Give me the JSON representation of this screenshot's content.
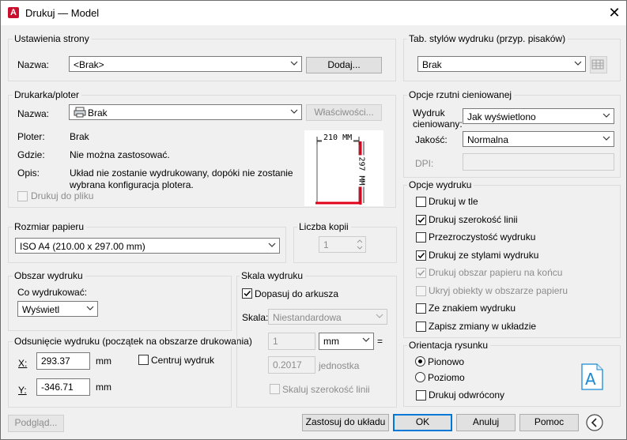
{
  "window": {
    "title": "Drukuj — Model",
    "app_icon": "A"
  },
  "page_setup": {
    "group_label": "Ustawienia strony",
    "name_label": "Nazwa:",
    "name_value": "<Brak>",
    "add_button": "Dodaj..."
  },
  "printer": {
    "group_label": "Drukarka/ploter",
    "name_label": "Nazwa:",
    "name_value": "Brak",
    "properties_button": "Właściwości...",
    "plotter_label": "Ploter:",
    "plotter_value": "Brak",
    "where_label": "Gdzie:",
    "where_value": "Nie można zastosować.",
    "desc_label": "Opis:",
    "desc_line1": "Układ nie zostanie wydrukowany, dopóki nie zostanie",
    "desc_line2": "wybrana konfiguracja plotera.",
    "print_to_file": "Drukuj do pliku",
    "paper_width": "210 MM",
    "paper_height": "297 MM"
  },
  "paper_size": {
    "group_label": "Rozmiar papieru",
    "value": "ISO A4 (210.00 x 297.00 mm)"
  },
  "copies": {
    "group_label": "Liczba kopii",
    "value": "1"
  },
  "plot_area": {
    "group_label": "Obszar wydruku",
    "what_label": "Co wydrukować:",
    "what_value": "Wyświetl"
  },
  "plot_offset": {
    "group_label": "Odsunięcie wydruku (początek na obszarze drukowania)",
    "x_label": "X:",
    "x_value": "293.37",
    "x_unit": "mm",
    "y_label": "Y:",
    "y_value": "-346.71",
    "y_unit": "mm",
    "center": "Centruj wydruk"
  },
  "plot_scale": {
    "group_label": "Skala wydruku",
    "fit_to_paper": "Dopasuj do arkusza",
    "scale_label": "Skala:",
    "scale_value": "Niestandardowa",
    "value1": "1",
    "unit_value": "mm",
    "equals": "=",
    "value2": "0.2017",
    "unit2": "jednostka",
    "scale_lineweights": "Skaluj szerokość linii"
  },
  "plot_style_table": {
    "group_label": "Tab. stylów wydruku (przyp. pisaków)",
    "value": "Brak"
  },
  "shaded_viewport": {
    "group_label": "Opcje rzutni cieniowanej",
    "shade_label_1": "Wydruk",
    "shade_label_2": "cieniowany:",
    "shade_value": "Jak wyświetlono",
    "quality_label": "Jakość:",
    "quality_value": "Normalna",
    "dpi_label": "DPI:"
  },
  "plot_options": {
    "group_label": "Opcje wydruku",
    "items": [
      {
        "label": "Drukuj w tle",
        "checked": false,
        "disabled": false
      },
      {
        "label": "Drukuj szerokość linii",
        "checked": true,
        "disabled": false
      },
      {
        "label": "Przezroczystość wydruku",
        "checked": false,
        "disabled": false
      },
      {
        "label": "Drukuj ze stylami wydruku",
        "checked": true,
        "disabled": false
      },
      {
        "label": "Drukuj obszar papieru na końcu",
        "checked": true,
        "disabled": true
      },
      {
        "label": "Ukryj obiekty w obszarze papieru",
        "checked": false,
        "disabled": true
      },
      {
        "label": "Ze znakiem wydruku",
        "checked": false,
        "disabled": false
      },
      {
        "label": "Zapisz zmiany w układzie",
        "checked": false,
        "disabled": false
      }
    ]
  },
  "orientation": {
    "group_label": "Orientacja rysunku",
    "portrait": "Pionowo",
    "landscape": "Poziomo",
    "upside_down": "Drukuj odwrócony",
    "icon_letter": "A"
  },
  "footer": {
    "preview": "Podgląd...",
    "apply": "Zastosuj do układu",
    "ok": "OK",
    "cancel": "Anuluj",
    "help": "Pomoc"
  },
  "colors": {
    "accent": "#0078d7",
    "red": "#e0001a",
    "app_red": "#c8102e",
    "icon_blue": "#1a8ad4"
  }
}
